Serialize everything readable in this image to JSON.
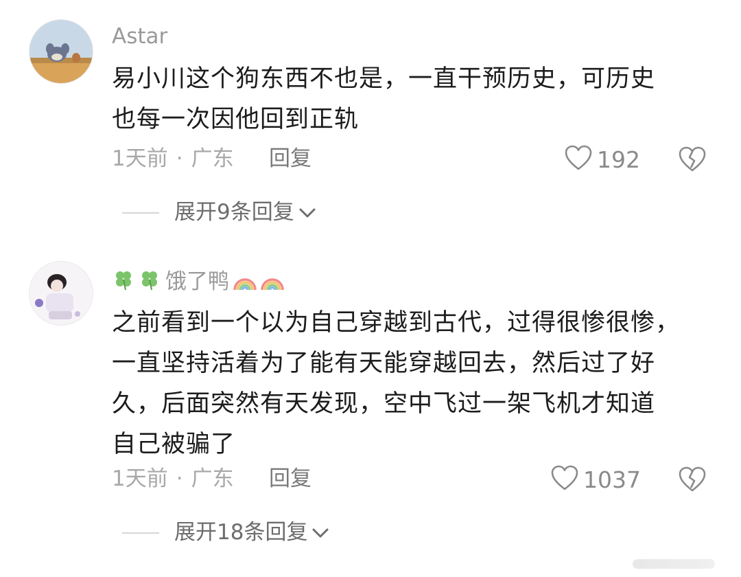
{
  "comments": [
    {
      "username": "Astar",
      "text_lines": [
        "易小川这个狗东西不也是，一直干预历史，可历史",
        "也每一次因他回到正轨"
      ],
      "time": "1天前",
      "dot": "·",
      "location": "广东",
      "reply_label": "回复",
      "likes": "192",
      "expand_label": "展开9条回复"
    },
    {
      "username": "饿了鸭",
      "username_prefix_icons": [
        "clover-icon",
        "clover-icon"
      ],
      "username_suffix_icons": [
        "rainbow-icon",
        "rainbow-icon"
      ],
      "text_lines": [
        "之前看到一个以为自己穿越到古代，过得很惨很惨，",
        "一直坚持活着为了能有天能穿越回去，然后过了好",
        "久，后面突然有天发现，空中飞过一架飞机才知道",
        "自己被骗了"
      ],
      "time": "1天前",
      "dot": "·",
      "location": "广东",
      "reply_label": "回复",
      "likes": "1037",
      "expand_label": "展开18条回复"
    }
  ],
  "colors": {
    "username": "#9a9a9a",
    "body_text": "#1c1c1c",
    "meta": "#a8a8a8",
    "icon": "#8a8a8a"
  }
}
